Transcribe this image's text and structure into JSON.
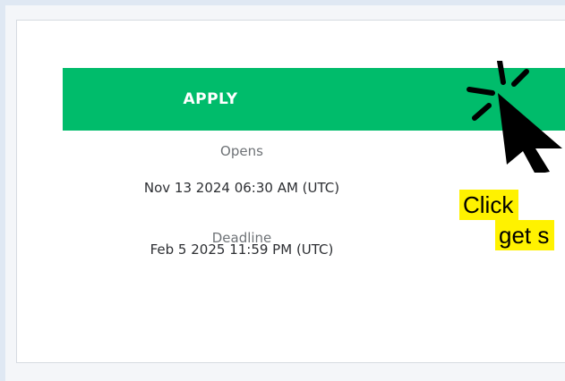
{
  "card": {
    "apply_label": "APPLY",
    "opens_label": "Opens",
    "opens_value": "Nov 13 2024 06:30 AM (UTC)",
    "deadline_label": "Deadline",
    "deadline_value": "Feb 5 2025 11:59 PM (UTC)"
  },
  "callout": {
    "line_1": "Click",
    "line_2": "get s"
  },
  "colors": {
    "button": "#00bc6b",
    "callout_highlight": "#fff200",
    "background": "#dfe8f3"
  },
  "icons": {
    "cursor": "click-cursor-icon",
    "burst": "click-burst-icon"
  }
}
